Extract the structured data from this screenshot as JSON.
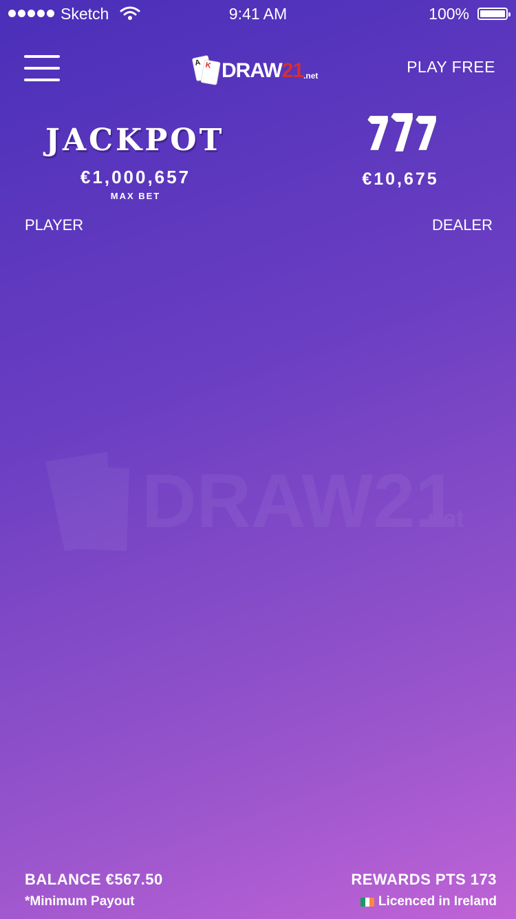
{
  "status_bar": {
    "carrier": "Sketch",
    "time": "9:41 AM",
    "battery": "100%",
    "icons": [
      "signal-dots-icon",
      "wifi-icon",
      "battery-icon"
    ]
  },
  "header": {
    "logo_main": "DRAW",
    "logo_num": "21",
    "logo_suffix": ".net",
    "logo_card_a": "A",
    "logo_card_k": "K",
    "play_free": "PLAY FREE",
    "menu_icon": "hamburger-menu-icon"
  },
  "jackpot": {
    "title": "JACKPOT",
    "amount": "€1,000,657",
    "note": "MAX BET"
  },
  "sevens": {
    "symbol": "777",
    "amount": "€10,675"
  },
  "table": {
    "player_label": "PLAYER",
    "dealer_label": "DEALER",
    "watermark_main": "DRAW21",
    "watermark_suffix": ".net"
  },
  "footer": {
    "balance": "BALANCE €567.50",
    "min_payout": "*Minimum Payout",
    "rewards": "REWARDS PTS 173",
    "licence": "Licenced in Ireland"
  },
  "colors": {
    "accent_red": "#d62f2f",
    "bg_top": "#4a2fb9",
    "bg_bottom": "#bf63d6",
    "flag_green": "#169b62",
    "flag_white": "#ffffff",
    "flag_orange": "#ff883e"
  }
}
